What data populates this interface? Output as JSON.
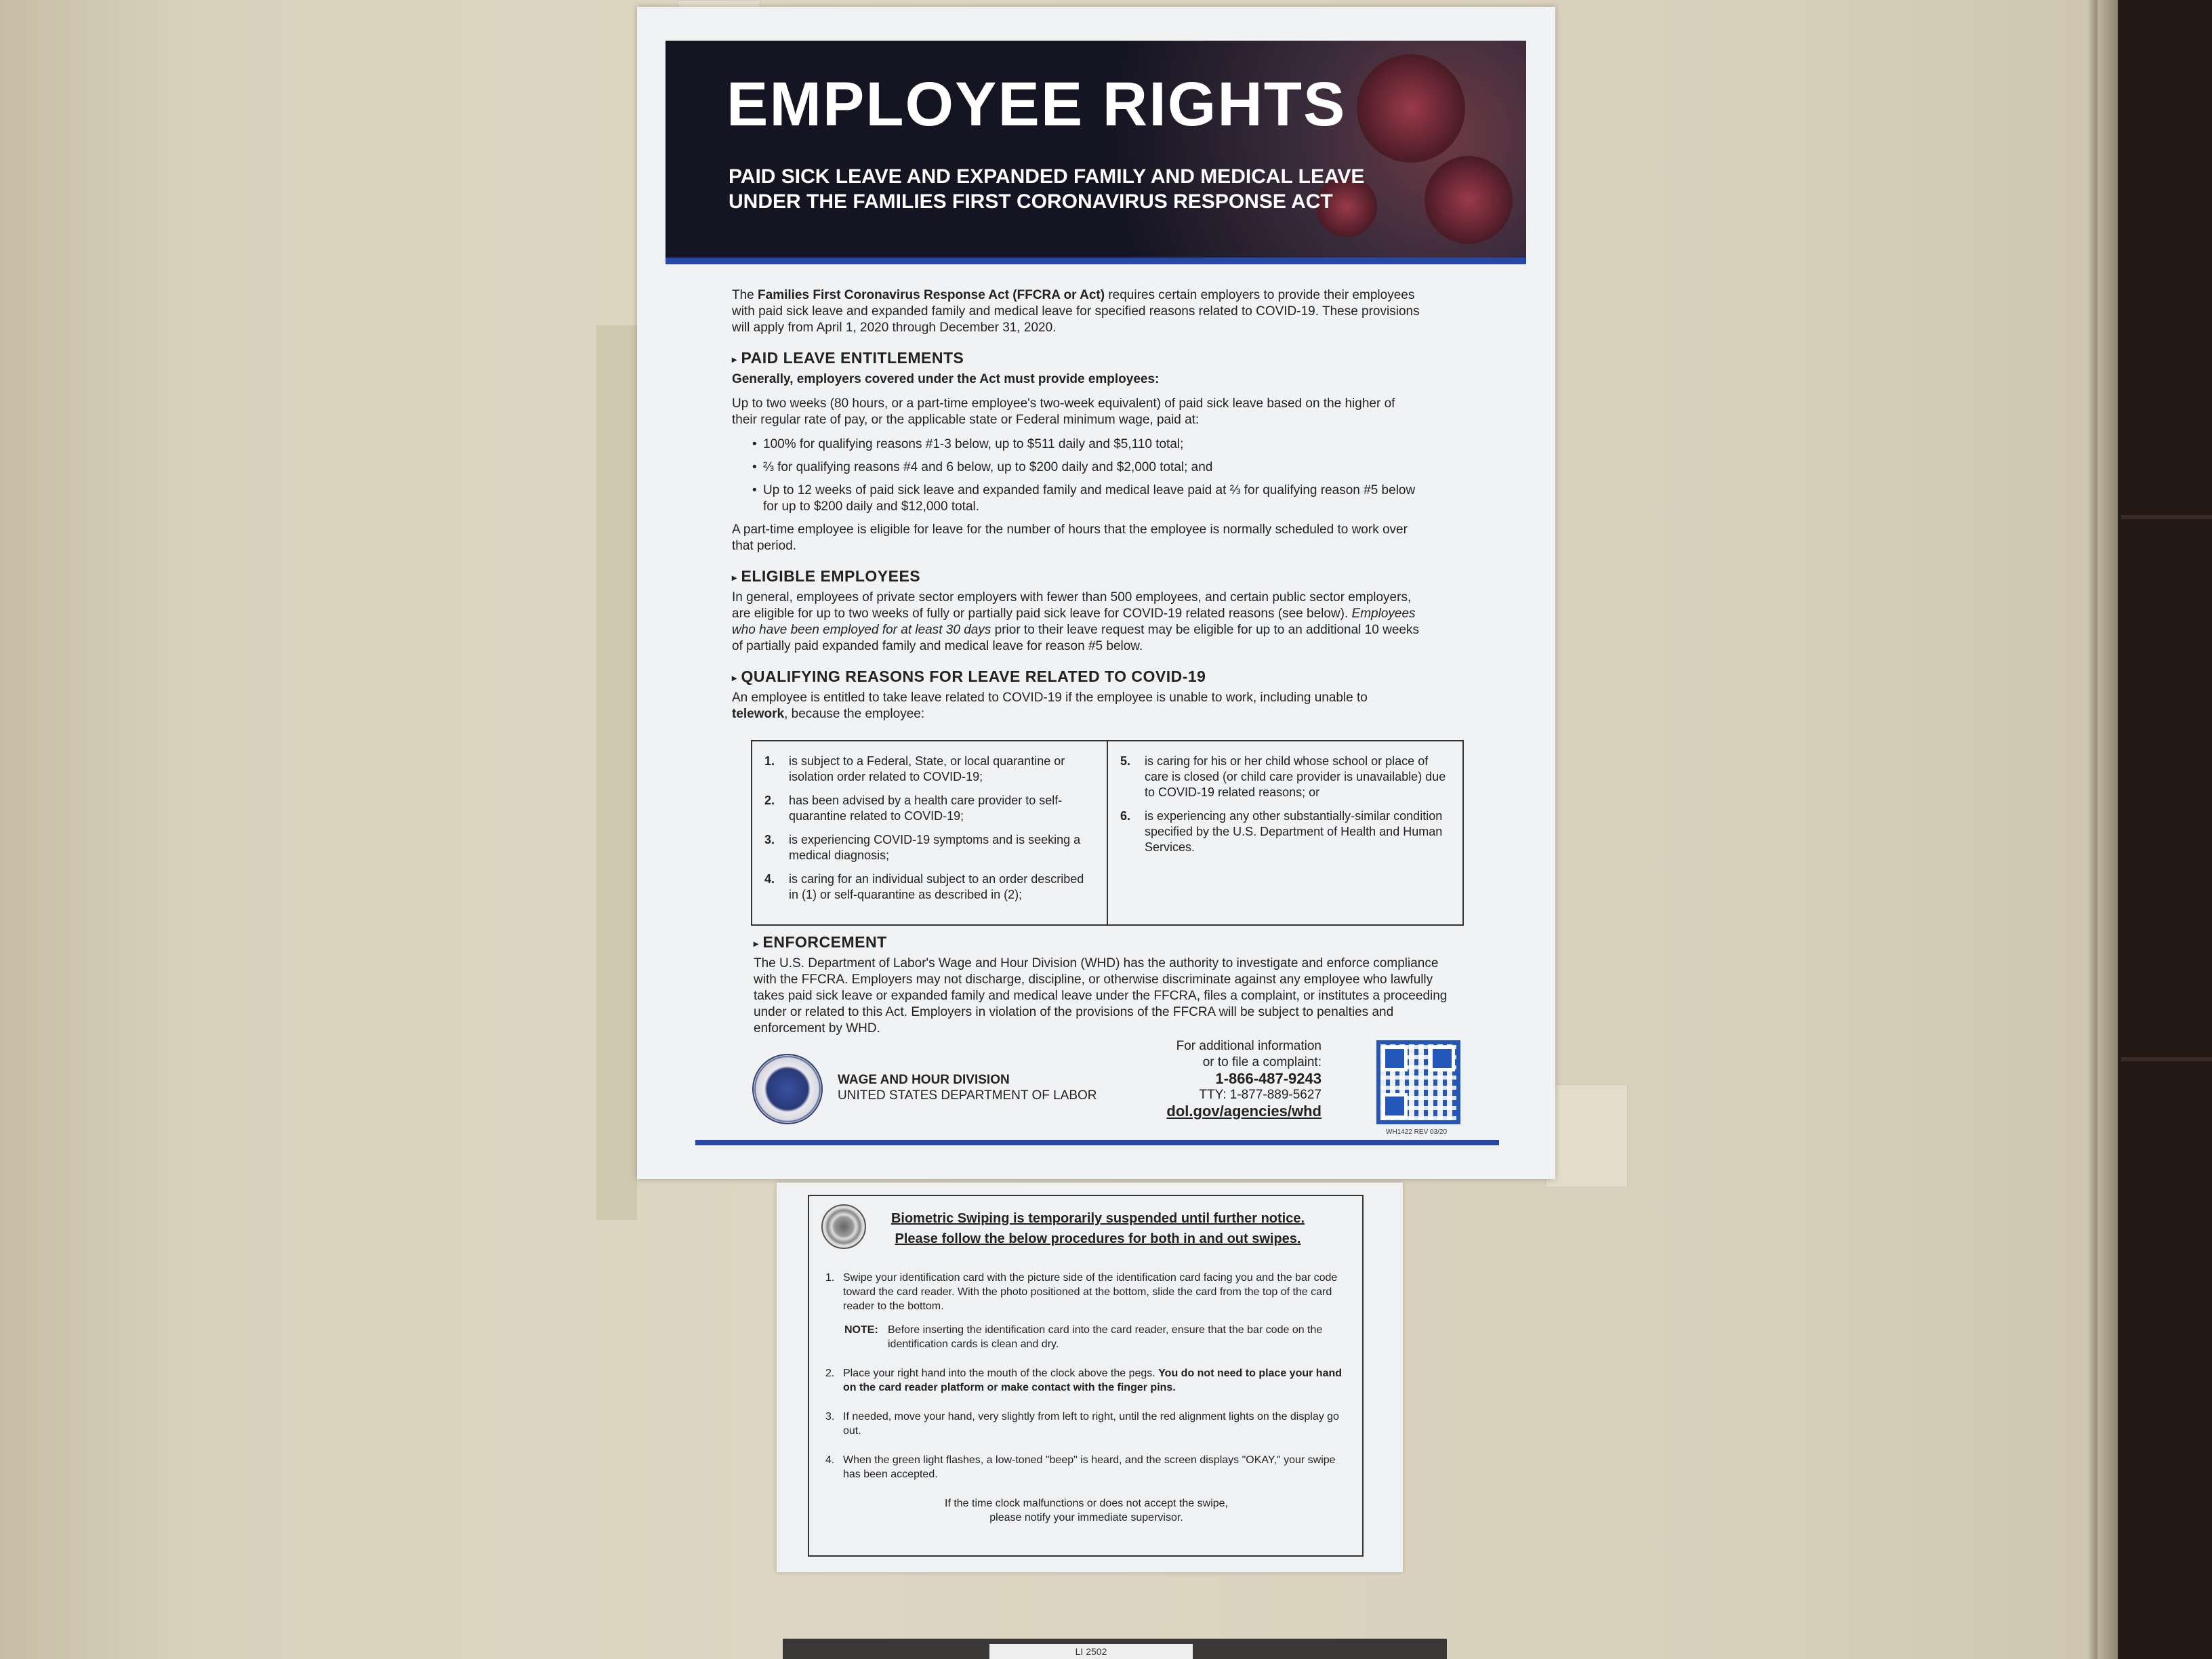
{
  "poster": {
    "title": "EMPLOYEE RIGHTS",
    "subtitle_1": "PAID SICK LEAVE AND EXPANDED FAMILY AND MEDICAL LEAVE",
    "subtitle_2": "UNDER THE FAMILIES FIRST CORONAVIRUS RESPONSE ACT",
    "intro_lead": "The ",
    "intro_bold": "Families First Coronavirus Response Act (FFCRA or Act)",
    "intro_rest": " requires certain employers to provide their employees with paid sick leave and expanded family and medical leave for specified reasons related to COVID-19. These provisions will apply from April 1, 2020 through December 31, 2020.",
    "s1_heading": "PAID LEAVE ENTITLEMENTS",
    "s1_sub": "Generally, employers covered under the Act must provide employees:",
    "s1_text": "Up to two weeks (80 hours, or a part-time employee's two-week equivalent) of paid sick leave based on the higher of their regular rate of pay, or the applicable state or Federal minimum wage, paid at:",
    "s1_bullets": [
      "100% for qualifying reasons #1-3 below, up to $511 daily and $5,110 total;",
      "⅔ for qualifying reasons #4 and 6 below, up to $200 daily and $2,000 total; and",
      "Up to 12 weeks of paid sick leave and expanded family and medical leave paid at ⅔ for qualifying reason #5 below for up to $200 daily and $12,000 total."
    ],
    "s1_after": "A part-time employee is eligible for leave for the number of hours that the employee is normally scheduled to work over that period.",
    "s2_heading": "ELIGIBLE EMPLOYEES",
    "s2_text_1": "In general, employees of private sector employers with fewer than 500 employees, and certain public sector employers, are eligible for up to two weeks of fully or partially paid sick leave for COVID-19 related reasons (see below). ",
    "s2_text_italic": "Employees who have been employed for at least 30 days",
    "s2_text_2": " prior to their leave request may be eligible for up to an additional 10 weeks of partially paid expanded family and medical leave for reason #5 below.",
    "s3_heading": "QUALIFYING REASONS FOR LEAVE RELATED TO COVID-19",
    "s3_text_1": "An employee is entitled to take leave related to COVID-19 if the employee is unable to work, including unable to ",
    "s3_text_bold": "telework",
    "s3_text_2": ", because the employee:",
    "reasons_left": [
      {
        "n": "1.",
        "t": "is subject to a Federal, State, or local quarantine or isolation order related to COVID-19;"
      },
      {
        "n": "2.",
        "t": "has been advised by a health care provider to self-quarantine related to COVID-19;"
      },
      {
        "n": "3.",
        "t": "is experiencing COVID-19 symptoms and is seeking a medical diagnosis;"
      },
      {
        "n": "4.",
        "t": "is caring for an individual subject to an order described in (1) or self-quarantine as described in (2);"
      }
    ],
    "reasons_right": [
      {
        "n": "5.",
        "t": "is caring for his or her child whose school or place of care is closed (or child care provider is unavailable) due to COVID-19 related reasons; or"
      },
      {
        "n": "6.",
        "t": "is experiencing any other substantially-similar condition specified by the U.S. Department of Health and Human Services."
      }
    ],
    "s4_heading": "ENFORCEMENT",
    "s4_text": "The U.S. Department of Labor's Wage and Hour Division (WHD) has the authority to investigate and enforce compliance with the FFCRA. Employers may not discharge, discipline, or otherwise discriminate against any employee who lawfully takes paid sick leave or expanded family and medical leave under the FFCRA, files a complaint, or institutes a proceeding under or related to this Act. Employers in violation of the provisions of the FFCRA will be subject to penalties and enforcement by WHD.",
    "org_1": "WAGE AND HOUR DIVISION",
    "org_2": "UNITED STATES DEPARTMENT OF LABOR",
    "info_1": "For additional information",
    "info_2": "or to file a complaint:",
    "phone": "1-866-487-9243",
    "tty": "TTY: 1-877-889-5627",
    "url": "dol.gov/agencies/whd",
    "rev": "WH1422  REV 03/20"
  },
  "notice": {
    "head_1": "Biometric Swiping is temporarily suspended until further notice.",
    "head_2": "Please follow the below procedures for both in and out swipes.",
    "item_1_n": "1.",
    "item_1": "Swipe your identification card with the picture side of the identification card facing you and the bar code toward the card reader. With the photo positioned at the bottom, slide the card from the top of the card reader to the bottom.",
    "note_label": "NOTE:",
    "note_text": "Before inserting the identification card into the card reader, ensure that the bar code on the identification cards is clean and dry.",
    "item_2_n": "2.",
    "item_2_a": "Place your right hand into the mouth of the clock above the pegs. ",
    "item_2_b": "You do not need to place your hand on the card reader platform or make contact with the finger pins.",
    "item_3_n": "3.",
    "item_3": "If needed, move your hand, very slightly from left to right, until the red alignment lights on the display go out.",
    "item_4_n": "4.",
    "item_4": "When the green light flashes, a low-toned \"beep\" is heard, and the screen displays \"OKAY,\" your swipe has been accepted.",
    "foot_1": "If the time clock malfunctions or does not accept the swipe,",
    "foot_2": "please notify your immediate supervisor."
  },
  "label_tag": "LI 2502"
}
